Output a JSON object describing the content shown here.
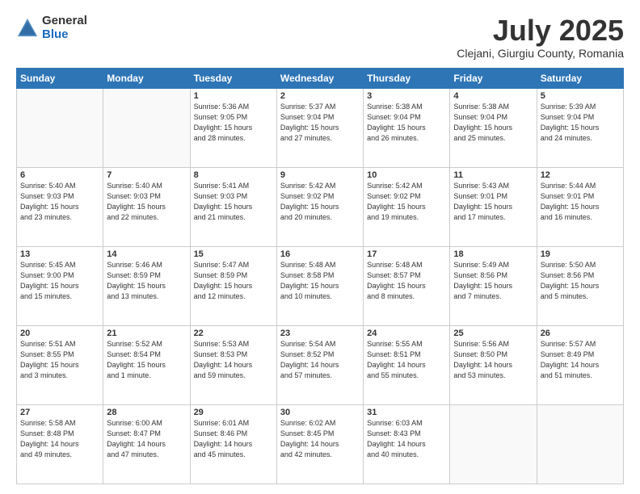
{
  "logo": {
    "general": "General",
    "blue": "Blue"
  },
  "header": {
    "title": "July 2025",
    "subtitle": "Clejani, Giurgiu County, Romania"
  },
  "weekdays": [
    "Sunday",
    "Monday",
    "Tuesday",
    "Wednesday",
    "Thursday",
    "Friday",
    "Saturday"
  ],
  "weeks": [
    [
      {
        "day": "",
        "info": ""
      },
      {
        "day": "",
        "info": ""
      },
      {
        "day": "1",
        "info": "Sunrise: 5:36 AM\nSunset: 9:05 PM\nDaylight: 15 hours\nand 28 minutes."
      },
      {
        "day": "2",
        "info": "Sunrise: 5:37 AM\nSunset: 9:04 PM\nDaylight: 15 hours\nand 27 minutes."
      },
      {
        "day": "3",
        "info": "Sunrise: 5:38 AM\nSunset: 9:04 PM\nDaylight: 15 hours\nand 26 minutes."
      },
      {
        "day": "4",
        "info": "Sunrise: 5:38 AM\nSunset: 9:04 PM\nDaylight: 15 hours\nand 25 minutes."
      },
      {
        "day": "5",
        "info": "Sunrise: 5:39 AM\nSunset: 9:04 PM\nDaylight: 15 hours\nand 24 minutes."
      }
    ],
    [
      {
        "day": "6",
        "info": "Sunrise: 5:40 AM\nSunset: 9:03 PM\nDaylight: 15 hours\nand 23 minutes."
      },
      {
        "day": "7",
        "info": "Sunrise: 5:40 AM\nSunset: 9:03 PM\nDaylight: 15 hours\nand 22 minutes."
      },
      {
        "day": "8",
        "info": "Sunrise: 5:41 AM\nSunset: 9:03 PM\nDaylight: 15 hours\nand 21 minutes."
      },
      {
        "day": "9",
        "info": "Sunrise: 5:42 AM\nSunset: 9:02 PM\nDaylight: 15 hours\nand 20 minutes."
      },
      {
        "day": "10",
        "info": "Sunrise: 5:42 AM\nSunset: 9:02 PM\nDaylight: 15 hours\nand 19 minutes."
      },
      {
        "day": "11",
        "info": "Sunrise: 5:43 AM\nSunset: 9:01 PM\nDaylight: 15 hours\nand 17 minutes."
      },
      {
        "day": "12",
        "info": "Sunrise: 5:44 AM\nSunset: 9:01 PM\nDaylight: 15 hours\nand 16 minutes."
      }
    ],
    [
      {
        "day": "13",
        "info": "Sunrise: 5:45 AM\nSunset: 9:00 PM\nDaylight: 15 hours\nand 15 minutes."
      },
      {
        "day": "14",
        "info": "Sunrise: 5:46 AM\nSunset: 8:59 PM\nDaylight: 15 hours\nand 13 minutes."
      },
      {
        "day": "15",
        "info": "Sunrise: 5:47 AM\nSunset: 8:59 PM\nDaylight: 15 hours\nand 12 minutes."
      },
      {
        "day": "16",
        "info": "Sunrise: 5:48 AM\nSunset: 8:58 PM\nDaylight: 15 hours\nand 10 minutes."
      },
      {
        "day": "17",
        "info": "Sunrise: 5:48 AM\nSunset: 8:57 PM\nDaylight: 15 hours\nand 8 minutes."
      },
      {
        "day": "18",
        "info": "Sunrise: 5:49 AM\nSunset: 8:56 PM\nDaylight: 15 hours\nand 7 minutes."
      },
      {
        "day": "19",
        "info": "Sunrise: 5:50 AM\nSunset: 8:56 PM\nDaylight: 15 hours\nand 5 minutes."
      }
    ],
    [
      {
        "day": "20",
        "info": "Sunrise: 5:51 AM\nSunset: 8:55 PM\nDaylight: 15 hours\nand 3 minutes."
      },
      {
        "day": "21",
        "info": "Sunrise: 5:52 AM\nSunset: 8:54 PM\nDaylight: 15 hours\nand 1 minute."
      },
      {
        "day": "22",
        "info": "Sunrise: 5:53 AM\nSunset: 8:53 PM\nDaylight: 14 hours\nand 59 minutes."
      },
      {
        "day": "23",
        "info": "Sunrise: 5:54 AM\nSunset: 8:52 PM\nDaylight: 14 hours\nand 57 minutes."
      },
      {
        "day": "24",
        "info": "Sunrise: 5:55 AM\nSunset: 8:51 PM\nDaylight: 14 hours\nand 55 minutes."
      },
      {
        "day": "25",
        "info": "Sunrise: 5:56 AM\nSunset: 8:50 PM\nDaylight: 14 hours\nand 53 minutes."
      },
      {
        "day": "26",
        "info": "Sunrise: 5:57 AM\nSunset: 8:49 PM\nDaylight: 14 hours\nand 51 minutes."
      }
    ],
    [
      {
        "day": "27",
        "info": "Sunrise: 5:58 AM\nSunset: 8:48 PM\nDaylight: 14 hours\nand 49 minutes."
      },
      {
        "day": "28",
        "info": "Sunrise: 6:00 AM\nSunset: 8:47 PM\nDaylight: 14 hours\nand 47 minutes."
      },
      {
        "day": "29",
        "info": "Sunrise: 6:01 AM\nSunset: 8:46 PM\nDaylight: 14 hours\nand 45 minutes."
      },
      {
        "day": "30",
        "info": "Sunrise: 6:02 AM\nSunset: 8:45 PM\nDaylight: 14 hours\nand 42 minutes."
      },
      {
        "day": "31",
        "info": "Sunrise: 6:03 AM\nSunset: 8:43 PM\nDaylight: 14 hours\nand 40 minutes."
      },
      {
        "day": "",
        "info": ""
      },
      {
        "day": "",
        "info": ""
      }
    ]
  ]
}
